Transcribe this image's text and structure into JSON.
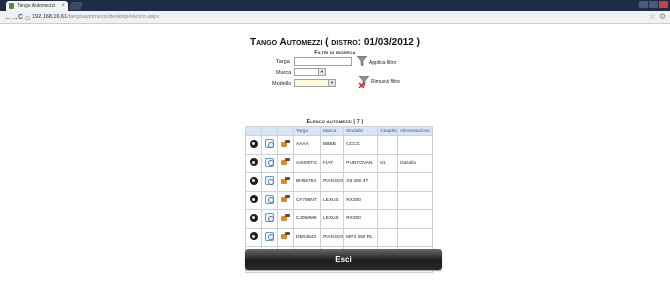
{
  "browser": {
    "tab_title": "Tango Automezzi",
    "tab_close": "×",
    "url_host": "192.168.16.61",
    "url_path": "/tangoautomezzi/desktop/elenco.aspx",
    "back": "←",
    "forward": "→",
    "reload": "C",
    "home": "⌂",
    "star": "☆",
    "wrench": "⚙"
  },
  "page": {
    "title": "Tango Automezzi ( distro: 01/03/2012 )",
    "filters_heading": "Filtri di ricerca",
    "list_heading": "Elenco automezzi ( 7 )",
    "exit_label": "Esci"
  },
  "filters": {
    "targa_label": "Targa",
    "targa_value": "",
    "marca_label": "Marca",
    "marca_value": "",
    "modello_label": "Modello",
    "modello_value": "",
    "apply_label": "Applica filtro",
    "remove_label": "Rimuovi filtro"
  },
  "table": {
    "columns": [
      "Targa",
      "Marca",
      "Modello",
      "Ceapite",
      "Alimentazione"
    ],
    "rows": [
      {
        "targa": "AAAA",
        "marca": "BBBB",
        "modello": "CCCC",
        "ceapite": "",
        "alimentazione": ""
      },
      {
        "targa": "AX000TG",
        "marca": "FIAT",
        "modello": "PUNTOVAN",
        "ceapite": "01",
        "alimentazione": "Gasolio"
      },
      {
        "targa": "BH66764",
        "marca": "PIAGGIO",
        "modello": "X9 250 4T",
        "ceapite": "",
        "alimentazione": ""
      },
      {
        "targa": "CF798NT",
        "marca": "LEXUS",
        "modello": "RX300",
        "ceapite": "",
        "alimentazione": ""
      },
      {
        "targa": "CJ068MK",
        "marca": "LEXUS",
        "modello": "RX300",
        "ceapite": "",
        "alimentazione": ""
      },
      {
        "targa": "DB04543",
        "marca": "PIAGGIO",
        "modello": "MP3 250 RL",
        "ceapite": "",
        "alimentazione": ""
      },
      {
        "targa": "DY024YZ",
        "marca": "FIAT",
        "modello": "PANDA VAN",
        "ceapite": "",
        "alimentazione": ""
      }
    ],
    "pager": "1"
  }
}
